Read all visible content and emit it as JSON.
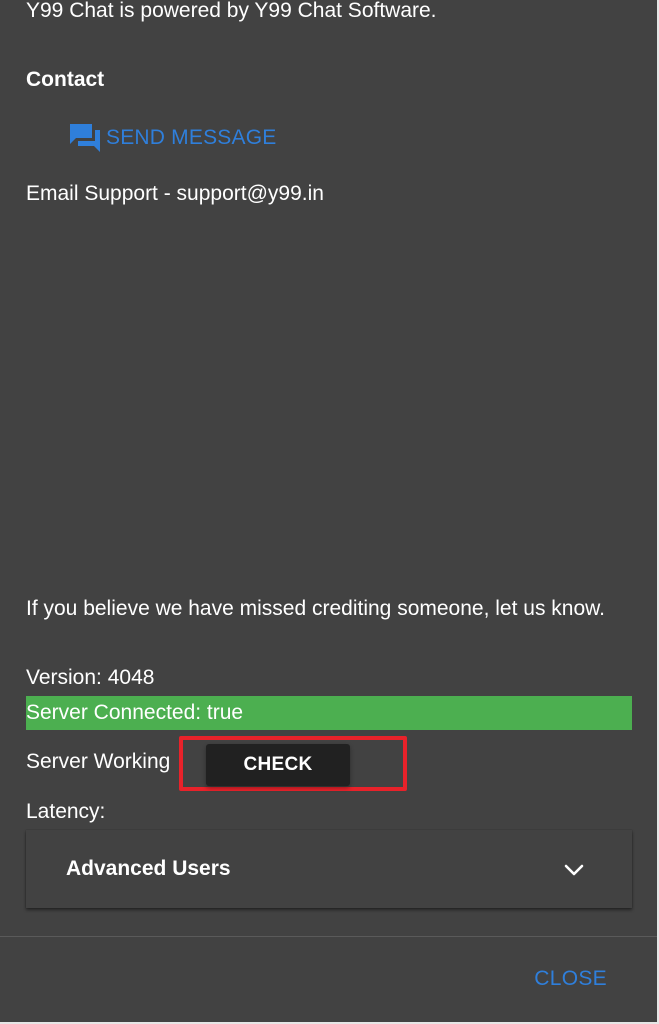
{
  "about": {
    "powered_by": "Y99 Chat is powered by Y99 Chat Software."
  },
  "contact": {
    "heading": "Contact",
    "send_message_label": "SEND MESSAGE",
    "send_message_icon": "chat-bubble-icon",
    "email_support": "Email Support - support@y99.in"
  },
  "credits": {
    "note": "If you believe we have missed crediting someone, let us know."
  },
  "status": {
    "version": "Version: 4048",
    "server_connected": "Server Connected: true",
    "server_working_label": "Server Working",
    "check_label": "CHECK",
    "latency_label": "Latency:"
  },
  "advanced": {
    "title": "Advanced Users",
    "chevron_icon": "chevron-down-icon"
  },
  "actions": {
    "close_label": "CLOSE"
  },
  "colors": {
    "dialog_bg": "#424242",
    "accent_blue": "#2f7fdb",
    "success_green": "#4caf50",
    "highlight_red": "#e8222a",
    "button_dark": "#212121"
  }
}
